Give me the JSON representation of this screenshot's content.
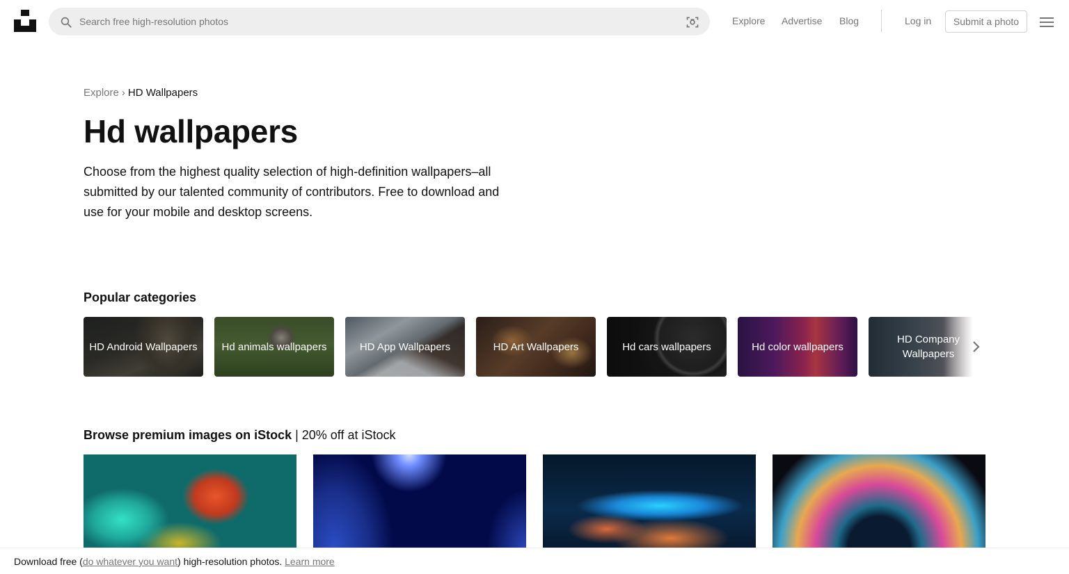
{
  "header": {
    "search_placeholder": "Search free high-resolution photos",
    "nav": {
      "explore": "Explore",
      "advertise": "Advertise",
      "blog": "Blog",
      "login": "Log in"
    },
    "submit_label": "Submit a photo"
  },
  "breadcrumb": {
    "parent": "Explore",
    "separator": "›",
    "current": "HD Wallpapers"
  },
  "page": {
    "title": "Hd wallpapers",
    "description": "Choose from the highest quality selection of high-definition wallpapers–all submitted by our talented community of contributors. Free to download and use for your mobile and desktop screens."
  },
  "popular": {
    "title": "Popular categories",
    "items": [
      {
        "label": "HD Android Wallpapers"
      },
      {
        "label": "Hd animals wallpapers"
      },
      {
        "label": "HD App Wallpapers"
      },
      {
        "label": "HD Art Wallpapers"
      },
      {
        "label": "Hd cars wallpapers"
      },
      {
        "label": "Hd color wallpapers"
      },
      {
        "label": "HD Company Wallpapers"
      }
    ]
  },
  "premium": {
    "title_bold": "Browse premium images on iStock",
    "title_light": " | 20% off at iStock"
  },
  "footer": {
    "prefix": "Download free (",
    "link": "do whatever you want",
    "middle": ") high-resolution photos.",
    "learn_more": "Learn more"
  },
  "colors": {
    "text": "#111111",
    "muted": "#767676",
    "search_bg": "#eeeeee",
    "border": "#d1d1d1"
  }
}
